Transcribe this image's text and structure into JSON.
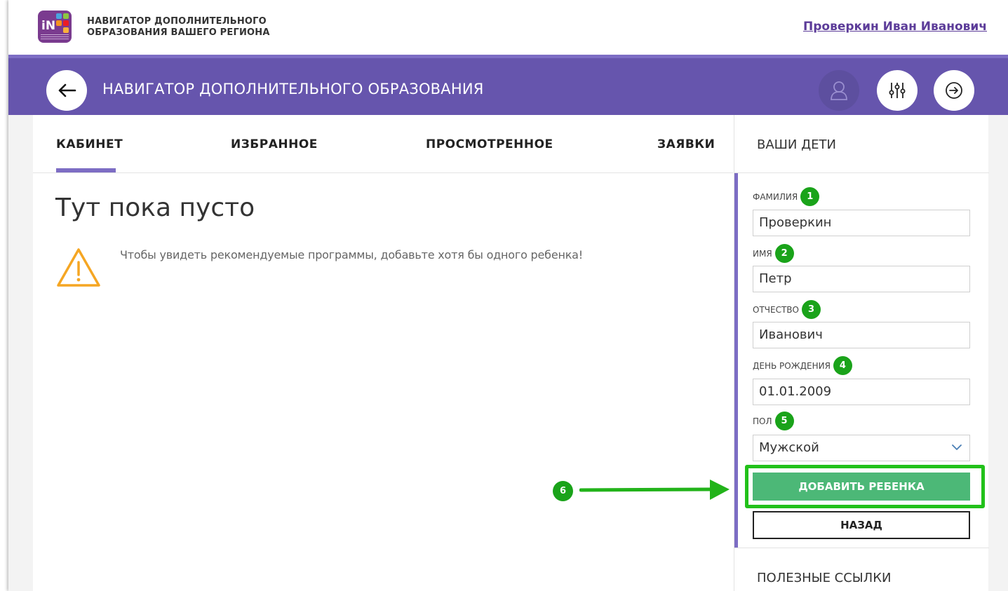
{
  "header": {
    "site_name_line1": "НАВИГАТОР ДОПОЛНИТЕЛЬНОГО",
    "site_name_line2": "ОБРАЗОВАНИЯ ВАШЕГО РЕГИОНА",
    "user_name": "Проверкин Иван Иванович",
    "logo_letters": "iN"
  },
  "navbar": {
    "title": "НАВИГАТОР ДОПОЛНИТЕЛЬНОГО ОБРАЗОВАНИЯ",
    "icons": [
      "back-arrow-icon",
      "user-icon",
      "filter-sliders-icon",
      "logout-arrow-icon"
    ]
  },
  "tabs": [
    {
      "label": "КАБИНЕТ",
      "active": true
    },
    {
      "label": "ИЗБРАННОЕ",
      "active": false
    },
    {
      "label": "ПРОСМОТРЕННОЕ",
      "active": false
    },
    {
      "label": "ЗАЯВКИ",
      "active": false
    }
  ],
  "main": {
    "empty_title": "Тут пока пусто",
    "warning_text": "Чтобы увидеть рекомендуемые программы, добавьте хотя бы одного ребенка!"
  },
  "sidebar": {
    "title": "ВАШИ ДЕТИ",
    "fields": [
      {
        "label": "ФАМИЛИЯ",
        "badge": "1",
        "value": "Проверкин"
      },
      {
        "label": "ИМЯ",
        "badge": "2",
        "value": "Петр"
      },
      {
        "label": "ОТЧЕСТВО",
        "badge": "3",
        "value": "Иванович"
      },
      {
        "label": "ДЕНЬ РОЖДЕНИЯ",
        "badge": "4",
        "value": "01.01.2009"
      },
      {
        "label": "ПОЛ",
        "badge": "5",
        "value": "Мужской"
      }
    ],
    "add_button": "ДОБАВИТЬ РЕБЕНКА",
    "back_button": "НАЗАД",
    "useful_links": "ПОЛЕЗНЫЕ ССЫЛКИ"
  },
  "annotation": {
    "badge": "6"
  },
  "colors": {
    "purple_bar": "#6655ad",
    "accent_purple": "#7d6dc4",
    "user_link": "#5c3c99",
    "add_button": "#4cb877",
    "annotation_green": "#1aa31a",
    "highlight_green": "#22c11a",
    "warning_orange": "#f5a623"
  }
}
